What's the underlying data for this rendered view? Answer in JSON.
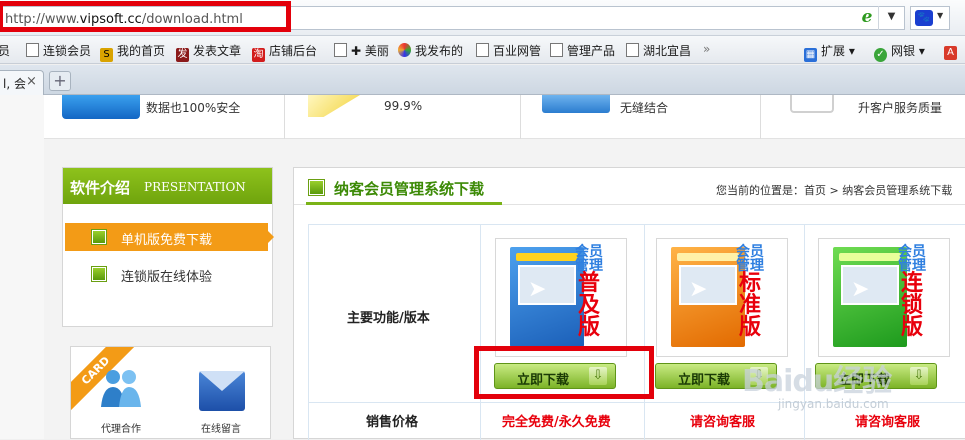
{
  "browser": {
    "url_prefix": "http://www.",
    "url_domain": "vipsoft.cc",
    "url_path": "/download.html",
    "tab_label": "l, 会",
    "tab_close": "×",
    "new_tab": "+",
    "bookmarks": [
      {
        "label": "员",
        "icon": "page-icon"
      },
      {
        "label": "连锁会员",
        "icon": "page-icon"
      },
      {
        "label": "我的首页",
        "icon": "sohu-icon"
      },
      {
        "label": "发表文章",
        "icon": "post-icon"
      },
      {
        "label": "店铺后台",
        "icon": "shop-icon"
      },
      {
        "label": "✚ 美丽",
        "icon": "page-icon"
      },
      {
        "label": "我发布的",
        "icon": "pinwheel-icon"
      },
      {
        "label": "百业网管",
        "icon": "page-icon"
      },
      {
        "label": "管理产品",
        "icon": "page-icon"
      },
      {
        "label": "湖北宜昌",
        "icon": "page-icon"
      }
    ],
    "more": "»",
    "extensions_label": "扩展",
    "netbank_label": "网银"
  },
  "features": [
    {
      "text": "数据也100%安全"
    },
    {
      "text": "99.9%"
    },
    {
      "text": "无缝结合"
    },
    {
      "text": "升客户服务质量"
    }
  ],
  "sidebar": {
    "title": "软件介绍",
    "subtitle": "PRESENTATION",
    "items": [
      {
        "label": "单机版免费下载",
        "active": true
      },
      {
        "label": "连锁版在线体验",
        "active": false
      }
    ]
  },
  "card": {
    "ribbon": "CARD",
    "agent_label": "代理合作",
    "message_label": "在线留言"
  },
  "main": {
    "title": "纳客会员管理系统下载",
    "breadcrumb": "您当前的位置是：首页 > 纳客会员管理系统下载",
    "row_label": "主要功能/版本",
    "price_label": "销售价格",
    "products": [
      {
        "name_top": "会员管理",
        "name_bot": "普及版",
        "box_color": "#1f6fd1",
        "download": "立即下载",
        "price": "完全免费/永久免费"
      },
      {
        "name_top": "会员管理",
        "name_bot": "标准版",
        "box_color": "#f08a0c",
        "download": "立即下载",
        "price": "请咨询客服"
      },
      {
        "name_top": "会员管理",
        "name_bot": "连锁版",
        "box_color": "#2aa72a",
        "download": "立即下载",
        "price": "请咨询客服"
      }
    ]
  },
  "watermark": {
    "text": "Baidu经验",
    "url": "jingyan.baidu.com"
  },
  "colors": {
    "highlight": "#e3000b",
    "accent_green": "#7ab317",
    "accent_orange": "#f39b16",
    "price_red": "#e8000c"
  }
}
